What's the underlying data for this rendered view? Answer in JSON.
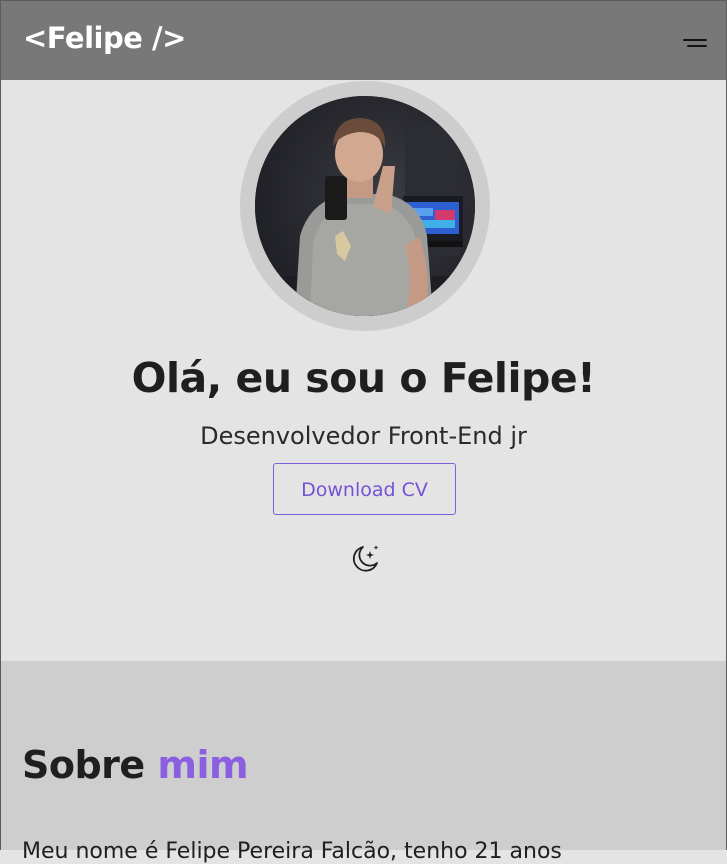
{
  "header": {
    "logo": "<Felipe />",
    "menu_icon": "hamburger-menu-icon"
  },
  "hero": {
    "avatar_alt": "profile-photo",
    "title": "Olá, eu sou o Felipe!",
    "subtitle": "Desenvolvedor Front-End jr",
    "cv_button": "Download CV",
    "theme_icon": "moon-stars-icon"
  },
  "about": {
    "title_part1": "Sobre ",
    "title_part2": "mim",
    "text_preview": "Meu nome é Felipe Pereira Falcão, tenho 21 anos"
  },
  "colors": {
    "header_bg": "#787878",
    "hero_bg": "#e4e4e4",
    "about_bg": "#cecece",
    "accent": "#8a5fe0",
    "button_text": "#7652d6"
  }
}
